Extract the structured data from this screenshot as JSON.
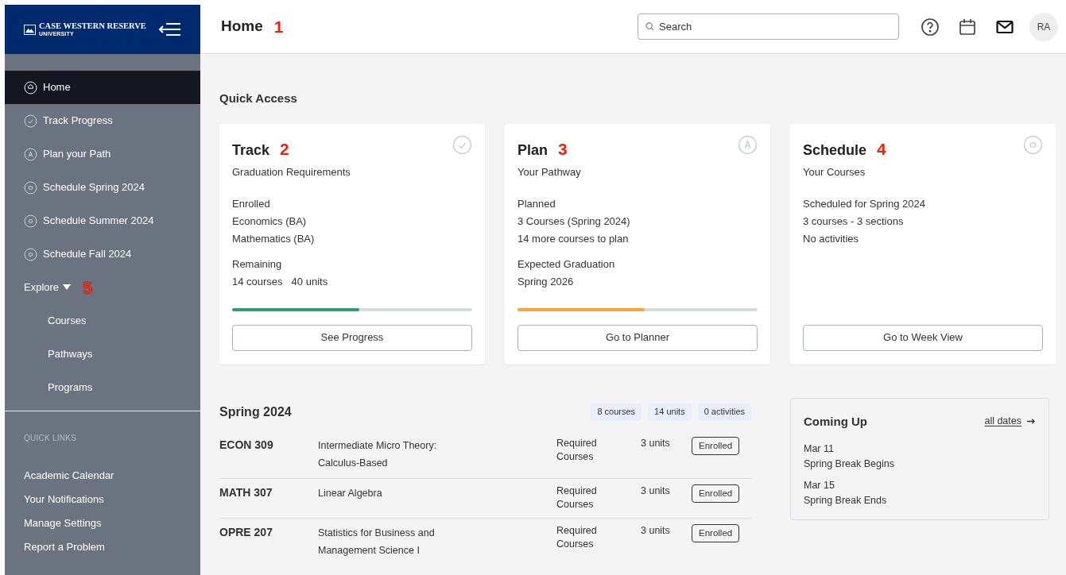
{
  "sidebar": {
    "logo": {
      "name": "CASE WESTERN RESERVE",
      "sub": "UNIVERSITY"
    },
    "items": [
      {
        "label": "Home",
        "kind": "home",
        "selected": true
      },
      {
        "label": "Track Progress",
        "kind": "check",
        "selected": false
      },
      {
        "label": "Plan your Path",
        "kind": "plan",
        "selected": false
      },
      {
        "label": "Schedule Spring 2024",
        "kind": "schedule",
        "selected": false
      },
      {
        "label": "Schedule Summer 2024",
        "kind": "schedule",
        "selected": false
      },
      {
        "label": "Schedule Fall 2024",
        "kind": "schedule",
        "selected": false
      }
    ],
    "explore": {
      "label": "Explore",
      "marker": "5",
      "expanded": true,
      "children": [
        {
          "label": "Courses"
        },
        {
          "label": "Pathways"
        },
        {
          "label": "Programs"
        }
      ]
    },
    "quick_links": {
      "title": "QUICK LINKS",
      "links": [
        "Academic Calendar",
        "Your Notifications",
        "Manage Settings",
        "Report a Problem"
      ]
    }
  },
  "header": {
    "title": "Home",
    "marker": "1",
    "search": {
      "placeholder": "Search"
    },
    "avatar": "RA"
  },
  "quick_access": {
    "title": "Quick Access",
    "cards": [
      {
        "title": "Track",
        "marker": "2",
        "subtitle": "Graduation Requirements",
        "kind": "check",
        "groups": [
          [
            "Enrolled",
            "Economics (BA)",
            "Mathematics (BA)"
          ],
          [
            "Remaining",
            [
              "14 courses",
              "40 units"
            ]
          ]
        ],
        "progress": {
          "level": 0.53,
          "color": "#2e9e73"
        },
        "button": "See Progress"
      },
      {
        "title": "Plan",
        "marker": "3",
        "subtitle": "Your Pathway",
        "kind": "plan",
        "groups": [
          [
            "Planned",
            "3 Courses (Spring 2024)",
            "14 more courses to plan"
          ],
          [
            "Expected Graduation",
            "Spring 2026"
          ]
        ],
        "progress": {
          "level": 0.53,
          "color": "#f5a53a"
        },
        "button": "Go to Planner"
      },
      {
        "title": "Schedule",
        "marker": "4",
        "subtitle": "Your Courses",
        "kind": "schedule",
        "groups": [
          [
            "Scheduled for Spring 2024",
            "3 courses - 3 sections",
            "No activities"
          ]
        ],
        "button": "Go to Week View"
      }
    ]
  },
  "term": {
    "title": "Spring 2024",
    "badges": [
      "8 courses",
      "14 units",
      "0 activities"
    ],
    "rows": [
      {
        "code": "ECON 309",
        "title": "Intermediate Micro Theory: Calculus-Based",
        "category": "Required Courses",
        "units": "3 units",
        "status": "Enrolled"
      },
      {
        "code": "MATH 307",
        "title": "Linear Algebra",
        "category": "Required Courses",
        "units": "3 units",
        "status": "Enrolled"
      },
      {
        "code": "OPRE 207",
        "title": "Statistics for Business and Management Science I",
        "category": "Required Courses",
        "units": "3 units",
        "status": "Enrolled"
      }
    ]
  },
  "coming_up": {
    "title": "Coming Up",
    "link": "all dates",
    "events": [
      {
        "date": "Mar 11",
        "name": "Spring Break Begins"
      },
      {
        "date": "Mar 15",
        "name": "Spring Break Ends"
      }
    ]
  }
}
